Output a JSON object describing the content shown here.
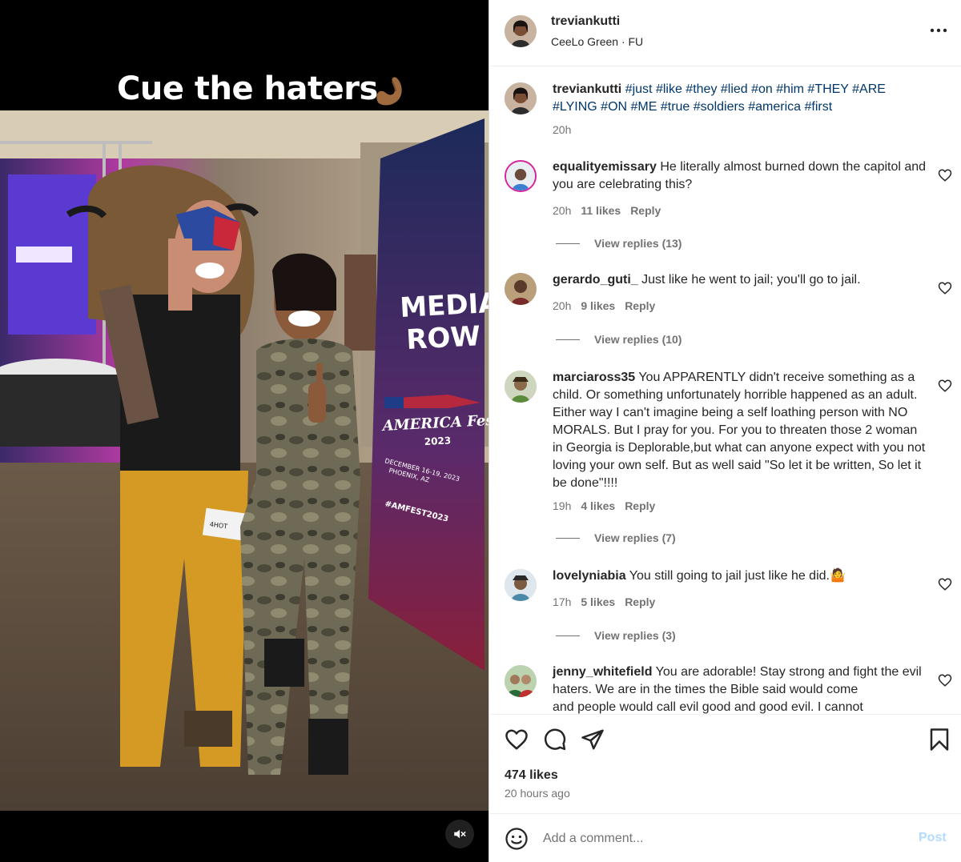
{
  "media": {
    "overlay_text": "Cue the haters",
    "overlay_emoji": "flexed-biceps-emoji",
    "banner_text_1": "MEDIA",
    "banner_text_2": "ROW",
    "banner_brand": "AMERICA Fest",
    "banner_year": "2023",
    "banner_dates": "DECEMBER 16-19, 2023",
    "banner_place": "PHOENIX, AZ",
    "banner_hashtag": "#AMFEST2023",
    "badge_text": "4HOT",
    "mute_icon": "speaker-muted-icon"
  },
  "header": {
    "username": "treviankutti",
    "song": "CeeLo Green · FU",
    "more_icon": "more-horizontal-icon"
  },
  "caption": {
    "username": "treviankutti",
    "text": "#just #like #they #lied #on #him #THEY #ARE #LYING #ON #ME #true #soldiers #america #first",
    "time": "20h"
  },
  "comments": [
    {
      "username": "equalityemissary",
      "text": "He literally almost burned down the capitol and you are celebrating this?",
      "time": "20h",
      "likes": "11 likes",
      "reply": "Reply",
      "view_replies": "View replies (13)"
    },
    {
      "username": "gerardo_guti_",
      "text": "Just like he went to jail; you'll go to jail.",
      "time": "20h",
      "likes": "9 likes",
      "reply": "Reply",
      "view_replies": "View replies (10)"
    },
    {
      "username": "marciaross35",
      "text": "You APPARENTLY didn't receive something as a child. Or something unfortunately horrible happened as an adult. Either way I can't imagine being a self loathing person with NO MORALS. But I pray for you. For you to threaten those 2 woman in Georgia is Deplorable,but what can anyone expect with you not loving your own self. But as well said \"So let it be written, So let it be done\"!!!!",
      "time": "19h",
      "likes": "4 likes",
      "reply": "Reply",
      "view_replies": "View replies (7)"
    },
    {
      "username": "lovelyniabia",
      "text": "You still going to jail just like he did.🤷",
      "time": "17h",
      "likes": "5 likes",
      "reply": "Reply",
      "view_replies": "View replies (3)"
    },
    {
      "username": "jenny_whitefield",
      "text": "You are adorable! Stay strong and fight the evil haters. We are in the times the Bible said would come",
      "text_clipped": "and people would call evil good and good evil. I cannot"
    }
  ],
  "actions": {
    "like_icon": "heart-icon",
    "comment_icon": "comment-bubble-icon",
    "share_icon": "paper-plane-icon",
    "save_icon": "bookmark-icon",
    "likes": "474 likes",
    "time_ago": "20 hours ago"
  },
  "add_comment": {
    "emoji_icon": "smiley-icon",
    "placeholder": "Add a comment...",
    "post_label": "Post"
  }
}
